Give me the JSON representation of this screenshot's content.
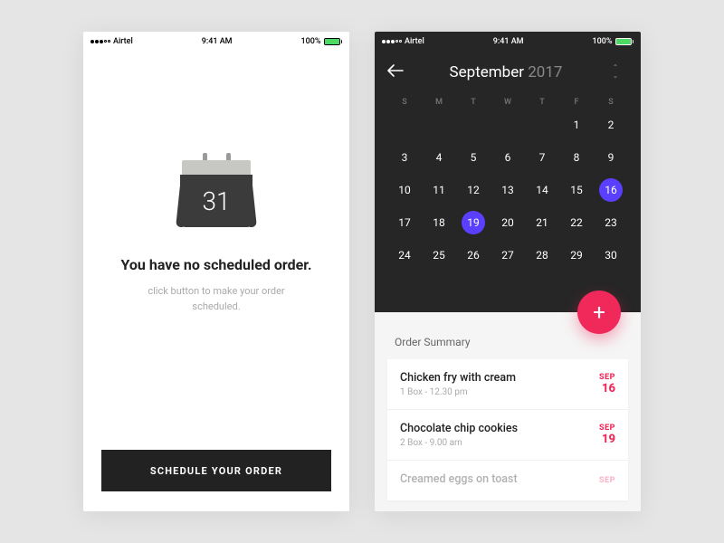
{
  "status": {
    "carrier": "Airtel",
    "time": "9:41 AM",
    "battery": "100%"
  },
  "screen1": {
    "calendar_day": "31",
    "title": "You have no scheduled order.",
    "subtitle": "click button to make your order scheduled.",
    "cta": "SCHEDULE YOUR ORDER"
  },
  "screen2": {
    "month": "September",
    "year": "2017",
    "weekdays": [
      "S",
      "M",
      "T",
      "W",
      "T",
      "F",
      "S"
    ],
    "leading_blanks": 5,
    "days_in_month": 30,
    "selected_days": [
      16,
      19
    ],
    "fab_icon": "+",
    "summary_title": "Order Summary",
    "orders": [
      {
        "name": "Chicken fry with cream",
        "meta": "1 Box - 12.30 pm",
        "month": "SEP",
        "day": "16"
      },
      {
        "name": "Chocolate chip cookies",
        "meta": "2 Box - 9.00 am",
        "month": "SEP",
        "day": "19"
      },
      {
        "name": "Creamed eggs on toast",
        "meta": "",
        "month": "SEP",
        "day": ""
      }
    ]
  }
}
